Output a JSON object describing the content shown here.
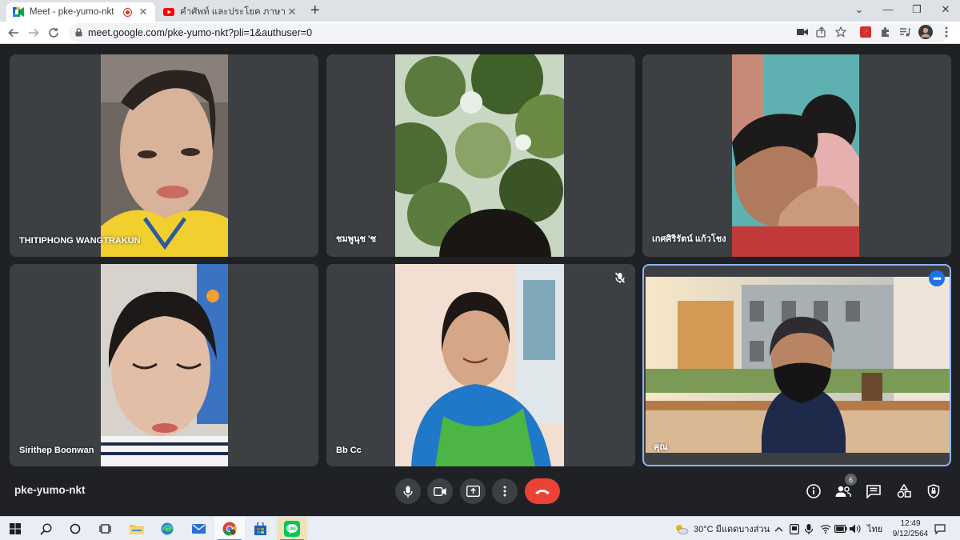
{
  "browser": {
    "tabs": [
      {
        "title": "Meet - pke-yumo-nkt",
        "favicon": "google-meet-icon",
        "recording": true,
        "active": true
      },
      {
        "title": "คำศัพท์ และประโยค ภาษาอังกฤษ ในชีวิ",
        "favicon": "youtube-icon",
        "active": false
      }
    ],
    "new_tab": "+",
    "window_controls": {
      "dropdown": "⌄",
      "minimize": "—",
      "maximize": "❐",
      "close": "✕"
    },
    "address": "meet.google.com/pke-yumo-nkt?pli=1&authuser=0"
  },
  "meet": {
    "participants": [
      {
        "name": "THITIPHONG WANGTRAKUN",
        "muted": false
      },
      {
        "name": "ชมพูนุช 'ช",
        "muted": false
      },
      {
        "name": "เกศศิริรัตน์ แก้วโชง",
        "muted": false
      },
      {
        "name": "Sirithep Boonwan",
        "muted": false
      },
      {
        "name": "Bb Cc",
        "muted": true
      },
      {
        "name": "คุณ",
        "muted": false,
        "self": true
      }
    ],
    "meeting_code": "pke-yumo-nkt",
    "people_count": "6",
    "controls": [
      "microphone-icon",
      "camera-icon",
      "present-screen-icon",
      "more-options-icon",
      "end-call-icon"
    ],
    "right_controls": [
      "info-icon",
      "people-icon",
      "chat-icon",
      "activities-icon",
      "host-controls-icon"
    ]
  },
  "taskbar": {
    "weather": "30°C  มีแดดบางส่วน",
    "language": "ไทย",
    "time": "12:49",
    "date": "9/12/2564"
  },
  "colors": {
    "meet_bg": "#202124",
    "tile_bg": "#3c4043",
    "hang_up": "#ea4335",
    "accent_blue": "#1a73e8"
  }
}
